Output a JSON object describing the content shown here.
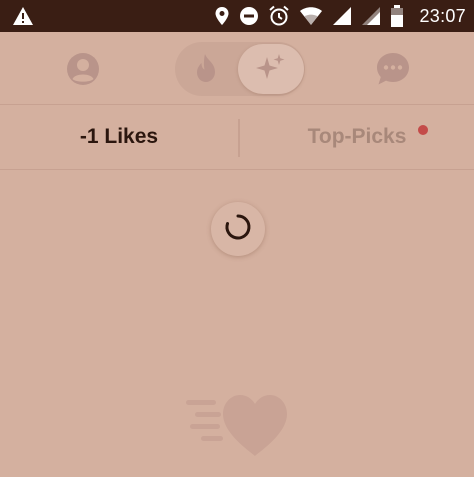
{
  "status_bar": {
    "time": "23:07",
    "icons": [
      "warning-icon",
      "location-icon",
      "do-not-disturb-icon",
      "alarm-icon",
      "wifi-icon",
      "signal-icon",
      "signal-icon",
      "battery-icon"
    ]
  },
  "top_nav": {
    "left_icon": "profile-icon",
    "segment_left_icon": "flame-icon",
    "segment_right_icon": "sparkle-icon",
    "right_icon": "chat-bubble-icon",
    "active_segment": "sparkle"
  },
  "tabs": [
    {
      "label": "-1 Likes",
      "active": true
    },
    {
      "label": "Top-Picks",
      "active": false,
      "has_notification": true
    }
  ],
  "colors": {
    "background": "#d4b09f",
    "status_bar": "#3a1e14",
    "active_tab_text": "#2b160e",
    "inactive_tab_text": "#a8887a",
    "notification_dot": "#c44b49",
    "icon_muted": "#b9948a"
  },
  "loading": true,
  "illustration": "flying-heart-icon"
}
